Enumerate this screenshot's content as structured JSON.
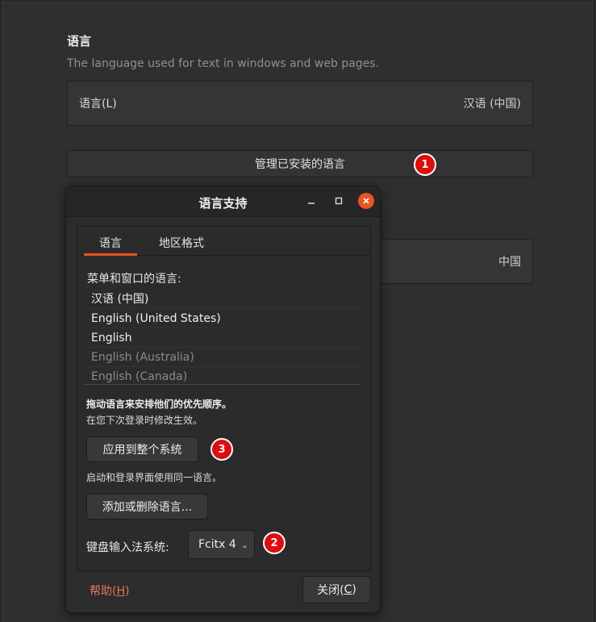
{
  "background": {
    "section_title": "语言",
    "section_desc": "The language used for text in windows and web pages.",
    "language_row": {
      "label": "语言(L)",
      "value": "汉语 (中国)"
    },
    "manage_button": "管理已安装的语言",
    "region_row": {
      "value": "中国"
    }
  },
  "dialog": {
    "title": "语言支持",
    "tabs": [
      {
        "label": "语言"
      },
      {
        "label": "地区格式"
      }
    ],
    "menu_label": "菜单和窗口的语言:",
    "languages": [
      {
        "label": "汉语 (中国)",
        "dim": false
      },
      {
        "label": "English (United States)",
        "dim": false
      },
      {
        "label": "English",
        "dim": false
      },
      {
        "label": "English (Australia)",
        "dim": true
      },
      {
        "label": "English (Canada)",
        "dim": true
      }
    ],
    "drag_hint": "拖动语言来安排他们的优先顺序。",
    "next_login": "在您下次登录时修改生效。",
    "apply_button": "应用到整个系统",
    "same_lang_note": "启动和登录界面使用同一语言。",
    "add_remove_button": "添加或删除语言...",
    "keyboard_label": "键盘输入法系统:",
    "keyboard_value": "Fcitx 4",
    "help_label": "帮助(",
    "help_mnemonic": "H",
    "help_suffix": ")",
    "close_label": "关闭(",
    "close_mnemonic": "C",
    "close_suffix": ")"
  },
  "badges": {
    "b1": "1",
    "b2": "2",
    "b3": "3"
  },
  "colors": {
    "accent": "#e95420",
    "badge": "#e10b0b",
    "help_link": "#e07b53"
  },
  "icons": {
    "minimize": "minimize-icon",
    "maximize": "maximize-icon",
    "close": "close-icon",
    "dropdown": "chevron-down-icon"
  }
}
